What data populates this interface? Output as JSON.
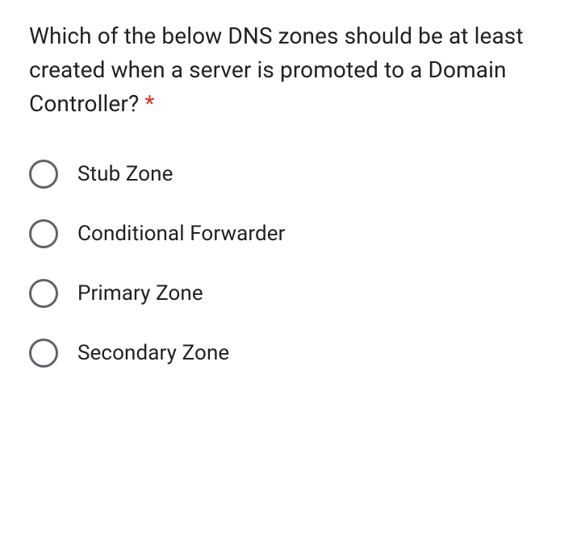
{
  "question": {
    "text": "Which of the below DNS zones should be at least created when a server is promoted to a Domain Controller?",
    "required_marker": "*"
  },
  "options": [
    {
      "label": "Stub Zone"
    },
    {
      "label": "Conditional Forwarder"
    },
    {
      "label": "Primary Zone"
    },
    {
      "label": "Secondary Zone"
    }
  ]
}
